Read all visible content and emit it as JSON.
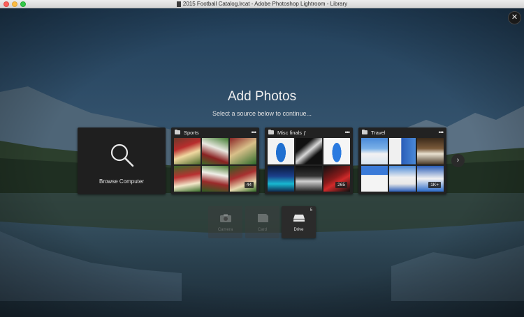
{
  "window": {
    "title": "2015 Football Catalog.lrcat - Adobe Photoshop Lightroom - Library"
  },
  "dialog": {
    "close_symbol": "✕",
    "title": "Add Photos",
    "subtitle": "Select a source below to continue...",
    "next_symbol": "›"
  },
  "sources": {
    "browse": {
      "label": "Browse Computer",
      "icon": "search-icon"
    },
    "collections": [
      {
        "title": "Sports",
        "count": "44",
        "menu": "•••"
      },
      {
        "title": "Misc finals ƒ",
        "count": "265",
        "menu": "•••"
      },
      {
        "title": "Travel",
        "count": "1K+",
        "menu": "•••"
      }
    ]
  },
  "devices": [
    {
      "label": "Camera",
      "icon": "camera-icon",
      "enabled": false,
      "count": ""
    },
    {
      "label": "Card",
      "icon": "card-icon",
      "enabled": false,
      "count": ""
    },
    {
      "label": "Drive",
      "icon": "drive-icon",
      "enabled": true,
      "count": "5"
    }
  ],
  "colors": {
    "traffic_close": "#fc605c",
    "traffic_min": "#fdbc40",
    "traffic_max": "#34c84a",
    "card_bg": "#222222"
  }
}
